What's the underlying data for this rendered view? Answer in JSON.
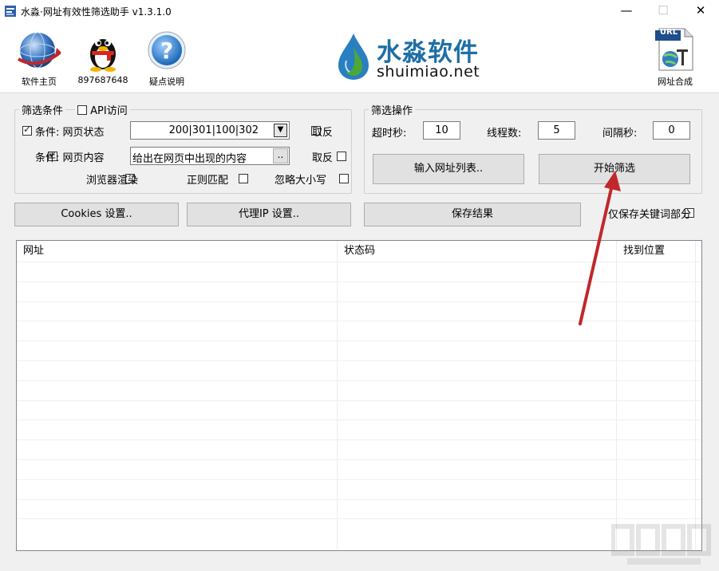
{
  "window": {
    "title": "水淼·网址有效性筛选助手 v1.3.1.0",
    "minimize": "—",
    "maximize": "☐",
    "close": "✕"
  },
  "toolbar": {
    "home_label": "软件主页",
    "qq_label": "897687648",
    "help_label": "疑点说明",
    "brand_cn": "水淼软件",
    "brand_en": "shuimiao.net",
    "url_badge": "URL",
    "url_merge_label": "网址合成"
  },
  "filter_conditions": {
    "legend": "筛选条件",
    "api_label": "API访问",
    "api_checked": false,
    "status_checked": true,
    "status_label": "条件: 网页状态",
    "status_value": "200|301|100|302",
    "status_invert_label": "取反",
    "content_checked": true,
    "content_label": "条件: 网页内容",
    "content_value": "给出在网页中出现的内容",
    "content_browse": "..",
    "content_invert_label": "取反",
    "browser_render_label": "浏览器渲染",
    "regex_label": "正则匹配",
    "ignore_case_label": "忽略大小写"
  },
  "filter_ops": {
    "legend": "筛选操作",
    "timeout_label": "超时秒:",
    "timeout_value": "10",
    "threads_label": "线程数:",
    "threads_value": "5",
    "interval_label": "间隔秒:",
    "interval_value": "0",
    "input_urls_label": "输入网址列表..",
    "start_label": "开始筛选"
  },
  "actions": {
    "cookies_label": "Cookies 设置..",
    "proxy_label": "代理IP 设置..",
    "save_label": "保存结果",
    "keyword_only_label": "仅保存关键词部分"
  },
  "table": {
    "columns": [
      "网址",
      "状态码",
      "找到位置"
    ]
  },
  "colors": {
    "arrow": "#c0282b",
    "brand_blue": "#1d6fa5",
    "drop_blue": "#2a7fc0",
    "drop_green": "#4aa83a"
  }
}
